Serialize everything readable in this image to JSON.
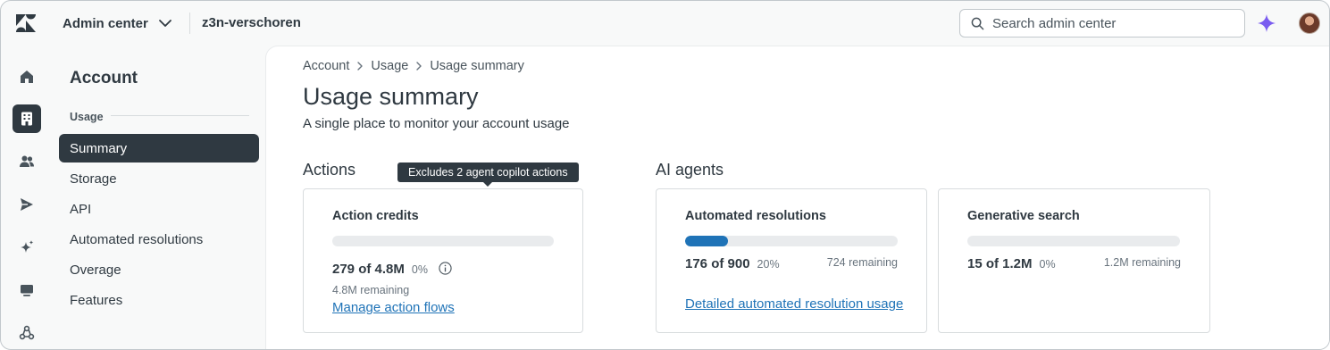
{
  "topbar": {
    "product_label": "Admin center",
    "subdomain": "z3n-verschoren",
    "search_placeholder": "Search admin center"
  },
  "rail": {
    "items": [
      {
        "icon": "home-icon"
      },
      {
        "icon": "building-icon",
        "active": true
      },
      {
        "icon": "people-icon"
      },
      {
        "icon": "send-icon"
      },
      {
        "icon": "sparkle-icon"
      },
      {
        "icon": "chat-icon"
      },
      {
        "icon": "recycle-icon"
      }
    ]
  },
  "sidenav": {
    "title": "Account",
    "group": "Usage",
    "items": [
      {
        "label": "Summary",
        "active": true
      },
      {
        "label": "Storage"
      },
      {
        "label": "API"
      },
      {
        "label": "Automated resolutions"
      },
      {
        "label": "Overage"
      },
      {
        "label": "Features"
      }
    ]
  },
  "main": {
    "breadcrumb": [
      "Account",
      "Usage",
      "Usage summary"
    ],
    "title": "Usage summary",
    "description": "A single place to monitor your account usage",
    "actions": {
      "section_title": "Actions",
      "tooltip": "Excludes 2 agent copilot actions",
      "card": {
        "title": "Action credits",
        "count": "279 of 4.8M",
        "percent": "0%",
        "progress": 0,
        "remaining": "4.8M remaining",
        "link": "Manage action flows"
      }
    },
    "ai_agents": {
      "section_title": "AI agents",
      "cards": [
        {
          "title": "Automated resolutions",
          "count": "176 of 900",
          "percent": "20%",
          "progress": 0.2,
          "remaining": "724 remaining",
          "link": "Detailed automated resolution usage"
        },
        {
          "title": "Generative search",
          "count": "15 of 1.2M",
          "percent": "0%",
          "progress": 0,
          "remaining": "1.2M remaining"
        }
      ]
    }
  },
  "colors": {
    "accent": "#1f73b7",
    "nav_active": "#2f3941",
    "ai_star": "#7a5cf0"
  }
}
